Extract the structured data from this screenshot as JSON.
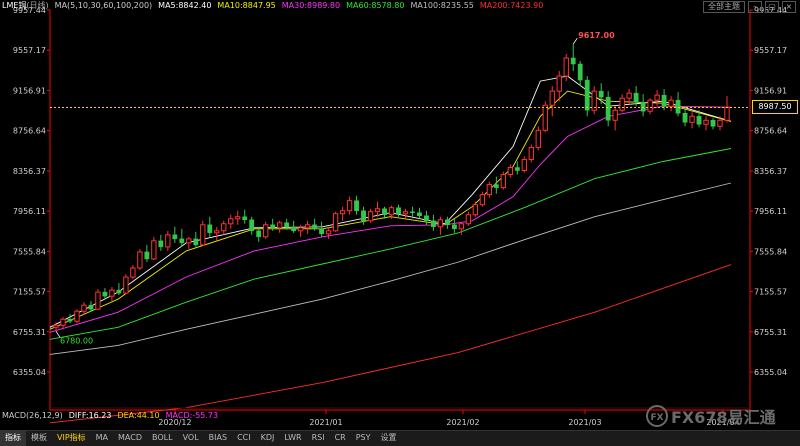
{
  "header": {
    "symbol": "LME铜",
    "period_tag": "(日线)",
    "ma_spec": "MA(5,10,30,60,100,200)",
    "ma5": "MA5:8842.40",
    "ma10": "MA10:8847.95",
    "ma30": "MA30:8989.80",
    "ma60": "MA60:8578.80",
    "ma100": "MA100:8235.55",
    "ma200": "MA200:7423.90",
    "top_button": "全部主题"
  },
  "colors": {
    "up": "#ff3232",
    "down": "#32c84b",
    "ma5": "#ffffff",
    "ma10": "#f0f000",
    "ma30": "#ff32ff",
    "ma60": "#32e632",
    "ma100": "#bebebe",
    "ma200": "#ff2d2d",
    "axis": "#ff0000",
    "last_price": "#ffd400",
    "macd_diff": "#ffffff",
    "macd_dea": "#ffd400",
    "macd_bar": "#ff32ff"
  },
  "chart_data": {
    "type": "candlestick",
    "y_ticks": [
      "9957.44",
      "9557.17",
      "9156.91",
      "8756.64",
      "8356.37",
      "7956.11",
      "7555.84",
      "7155.57",
      "6755.31",
      "6355.04"
    ],
    "ylim": [
      6355.04,
      9957.44
    ],
    "x_labels": [
      "2020/12",
      "2021/01",
      "2021/02",
      "2021/03",
      "2021/04"
    ],
    "annotations": {
      "high_label": "9617.00",
      "low_label": "6780.00",
      "last_price": "8987.50"
    },
    "grid": false,
    "last_price": 8987.5,
    "candles": [
      {
        "o": 6800,
        "h": 6850,
        "l": 6760,
        "c": 6820
      },
      {
        "o": 6820,
        "h": 6900,
        "l": 6790,
        "c": 6880
      },
      {
        "o": 6880,
        "h": 6930,
        "l": 6840,
        "c": 6860
      },
      {
        "o": 6860,
        "h": 6980,
        "l": 6840,
        "c": 6960
      },
      {
        "o": 6960,
        "h": 7050,
        "l": 6930,
        "c": 7020
      },
      {
        "o": 7020,
        "h": 7060,
        "l": 6950,
        "c": 6980
      },
      {
        "o": 6980,
        "h": 7180,
        "l": 6970,
        "c": 7150
      },
      {
        "o": 7150,
        "h": 7190,
        "l": 7080,
        "c": 7110
      },
      {
        "o": 7110,
        "h": 7200,
        "l": 7060,
        "c": 7170
      },
      {
        "o": 7170,
        "h": 7240,
        "l": 7120,
        "c": 7140
      },
      {
        "o": 7140,
        "h": 7330,
        "l": 7130,
        "c": 7300
      },
      {
        "o": 7300,
        "h": 7420,
        "l": 7280,
        "c": 7390
      },
      {
        "o": 7390,
        "h": 7580,
        "l": 7370,
        "c": 7550
      },
      {
        "o": 7550,
        "h": 7620,
        "l": 7450,
        "c": 7480
      },
      {
        "o": 7480,
        "h": 7700,
        "l": 7470,
        "c": 7660
      },
      {
        "o": 7660,
        "h": 7720,
        "l": 7560,
        "c": 7600
      },
      {
        "o": 7600,
        "h": 7760,
        "l": 7560,
        "c": 7720
      },
      {
        "o": 7720,
        "h": 7800,
        "l": 7640,
        "c": 7680
      },
      {
        "o": 7680,
        "h": 7780,
        "l": 7600,
        "c": 7640
      },
      {
        "o": 7640,
        "h": 7700,
        "l": 7580,
        "c": 7680
      },
      {
        "o": 7680,
        "h": 7750,
        "l": 7600,
        "c": 7620
      },
      {
        "o": 7620,
        "h": 7860,
        "l": 7610,
        "c": 7820
      },
      {
        "o": 7820,
        "h": 7900,
        "l": 7700,
        "c": 7740
      },
      {
        "o": 7740,
        "h": 7800,
        "l": 7660,
        "c": 7760
      },
      {
        "o": 7760,
        "h": 7860,
        "l": 7720,
        "c": 7830
      },
      {
        "o": 7830,
        "h": 7920,
        "l": 7780,
        "c": 7880
      },
      {
        "o": 7880,
        "h": 7960,
        "l": 7820,
        "c": 7900
      },
      {
        "o": 7900,
        "h": 7970,
        "l": 7830,
        "c": 7870
      },
      {
        "o": 7870,
        "h": 7900,
        "l": 7720,
        "c": 7760
      },
      {
        "o": 7760,
        "h": 7800,
        "l": 7650,
        "c": 7700
      },
      {
        "o": 7700,
        "h": 7850,
        "l": 7680,
        "c": 7820
      },
      {
        "o": 7820,
        "h": 7880,
        "l": 7760,
        "c": 7790
      },
      {
        "o": 7790,
        "h": 7860,
        "l": 7740,
        "c": 7840
      },
      {
        "o": 7840,
        "h": 7880,
        "l": 7770,
        "c": 7800
      },
      {
        "o": 7800,
        "h": 7860,
        "l": 7740,
        "c": 7760
      },
      {
        "o": 7760,
        "h": 7820,
        "l": 7700,
        "c": 7790
      },
      {
        "o": 7790,
        "h": 7860,
        "l": 7730,
        "c": 7820
      },
      {
        "o": 7820,
        "h": 7880,
        "l": 7760,
        "c": 7780
      },
      {
        "o": 7780,
        "h": 7850,
        "l": 7700,
        "c": 7730
      },
      {
        "o": 7730,
        "h": 7800,
        "l": 7680,
        "c": 7760
      },
      {
        "o": 7760,
        "h": 7950,
        "l": 7750,
        "c": 7930
      },
      {
        "o": 7930,
        "h": 8000,
        "l": 7860,
        "c": 7960
      },
      {
        "o": 7960,
        "h": 8100,
        "l": 7920,
        "c": 8060
      },
      {
        "o": 8060,
        "h": 8110,
        "l": 7920,
        "c": 7960
      },
      {
        "o": 7960,
        "h": 8000,
        "l": 7820,
        "c": 7860
      },
      {
        "o": 7860,
        "h": 7980,
        "l": 7840,
        "c": 7950
      },
      {
        "o": 7950,
        "h": 8050,
        "l": 7900,
        "c": 7980
      },
      {
        "o": 7980,
        "h": 8000,
        "l": 7880,
        "c": 7920
      },
      {
        "o": 7920,
        "h": 8010,
        "l": 7880,
        "c": 7990
      },
      {
        "o": 7990,
        "h": 8020,
        "l": 7900,
        "c": 7930
      },
      {
        "o": 7930,
        "h": 7980,
        "l": 7870,
        "c": 7950
      },
      {
        "o": 7950,
        "h": 8000,
        "l": 7900,
        "c": 7940
      },
      {
        "o": 7940,
        "h": 7990,
        "l": 7880,
        "c": 7910
      },
      {
        "o": 7910,
        "h": 7960,
        "l": 7820,
        "c": 7860
      },
      {
        "o": 7860,
        "h": 7920,
        "l": 7760,
        "c": 7800
      },
      {
        "o": 7800,
        "h": 7900,
        "l": 7720,
        "c": 7870
      },
      {
        "o": 7870,
        "h": 7900,
        "l": 7780,
        "c": 7820
      },
      {
        "o": 7820,
        "h": 7880,
        "l": 7740,
        "c": 7780
      },
      {
        "o": 7780,
        "h": 7850,
        "l": 7720,
        "c": 7830
      },
      {
        "o": 7830,
        "h": 7950,
        "l": 7810,
        "c": 7920
      },
      {
        "o": 7920,
        "h": 8050,
        "l": 7900,
        "c": 8020
      },
      {
        "o": 8020,
        "h": 8150,
        "l": 8000,
        "c": 8120
      },
      {
        "o": 8120,
        "h": 8250,
        "l": 8090,
        "c": 8220
      },
      {
        "o": 8220,
        "h": 8300,
        "l": 8130,
        "c": 8190
      },
      {
        "o": 8190,
        "h": 8350,
        "l": 8170,
        "c": 8320
      },
      {
        "o": 8320,
        "h": 8420,
        "l": 8290,
        "c": 8390
      },
      {
        "o": 8390,
        "h": 8450,
        "l": 8320,
        "c": 8360
      },
      {
        "o": 8360,
        "h": 8500,
        "l": 8340,
        "c": 8470
      },
      {
        "o": 8470,
        "h": 8620,
        "l": 8440,
        "c": 8590
      },
      {
        "o": 8590,
        "h": 8800,
        "l": 8560,
        "c": 8760
      },
      {
        "o": 8760,
        "h": 9050,
        "l": 8740,
        "c": 9010
      },
      {
        "o": 9010,
        "h": 9200,
        "l": 8900,
        "c": 9150
      },
      {
        "o": 9150,
        "h": 9350,
        "l": 9050,
        "c": 9300
      },
      {
        "o": 9300,
        "h": 9520,
        "l": 9250,
        "c": 9480
      },
      {
        "o": 9480,
        "h": 9617,
        "l": 9350,
        "c": 9420
      },
      {
        "o": 9420,
        "h": 9450,
        "l": 9200,
        "c": 9260
      },
      {
        "o": 9260,
        "h": 9300,
        "l": 8900,
        "c": 8960
      },
      {
        "o": 8960,
        "h": 9200,
        "l": 8920,
        "c": 9150
      },
      {
        "o": 9150,
        "h": 9230,
        "l": 9020,
        "c": 9090
      },
      {
        "o": 9090,
        "h": 9150,
        "l": 8800,
        "c": 8860
      },
      {
        "o": 8860,
        "h": 9000,
        "l": 8760,
        "c": 8960
      },
      {
        "o": 8960,
        "h": 9120,
        "l": 8940,
        "c": 9080
      },
      {
        "o": 9080,
        "h": 9170,
        "l": 9020,
        "c": 9130
      },
      {
        "o": 9130,
        "h": 9200,
        "l": 9000,
        "c": 9040
      },
      {
        "o": 9040,
        "h": 9120,
        "l": 8900,
        "c": 8950
      },
      {
        "o": 8950,
        "h": 9080,
        "l": 8920,
        "c": 9060
      },
      {
        "o": 9060,
        "h": 9160,
        "l": 9000,
        "c": 9110
      },
      {
        "o": 9110,
        "h": 9170,
        "l": 8960,
        "c": 9000
      },
      {
        "o": 9000,
        "h": 9100,
        "l": 8950,
        "c": 9060
      },
      {
        "o": 9060,
        "h": 9140,
        "l": 8900,
        "c": 8930
      },
      {
        "o": 8930,
        "h": 9000,
        "l": 8800,
        "c": 8840
      },
      {
        "o": 8840,
        "h": 8940,
        "l": 8780,
        "c": 8900
      },
      {
        "o": 8900,
        "h": 8960,
        "l": 8790,
        "c": 8820
      },
      {
        "o": 8820,
        "h": 8900,
        "l": 8760,
        "c": 8860
      },
      {
        "o": 8860,
        "h": 8880,
        "l": 8770,
        "c": 8800
      },
      {
        "o": 8800,
        "h": 8900,
        "l": 8760,
        "c": 8860
      },
      {
        "o": 8860,
        "h": 9100,
        "l": 8840,
        "c": 8987.5
      }
    ],
    "ma_lines": [
      {
        "name": "MA5",
        "points": [
          [
            0,
            6800
          ],
          [
            10,
            7150
          ],
          [
            20,
            7640
          ],
          [
            30,
            7790
          ],
          [
            40,
            7800
          ],
          [
            50,
            7940
          ],
          [
            58,
            7830
          ],
          [
            62,
            8120
          ],
          [
            68,
            8600
          ],
          [
            72,
            9250
          ],
          [
            76,
            9300
          ],
          [
            82,
            9000
          ],
          [
            90,
            9050
          ],
          [
            100,
            8850
          ]
        ]
      },
      {
        "name": "MA10",
        "points": [
          [
            0,
            6780
          ],
          [
            10,
            7080
          ],
          [
            20,
            7560
          ],
          [
            30,
            7780
          ],
          [
            40,
            7780
          ],
          [
            50,
            7900
          ],
          [
            58,
            7820
          ],
          [
            62,
            8000
          ],
          [
            68,
            8400
          ],
          [
            72,
            8900
          ],
          [
            76,
            9150
          ],
          [
            82,
            9050
          ],
          [
            90,
            9030
          ],
          [
            100,
            8848
          ]
        ]
      },
      {
        "name": "MA30",
        "points": [
          [
            0,
            6750
          ],
          [
            10,
            6950
          ],
          [
            20,
            7300
          ],
          [
            30,
            7560
          ],
          [
            40,
            7700
          ],
          [
            50,
            7810
          ],
          [
            58,
            7820
          ],
          [
            62,
            7860
          ],
          [
            68,
            8100
          ],
          [
            72,
            8420
          ],
          [
            76,
            8700
          ],
          [
            82,
            8900
          ],
          [
            90,
            9000
          ],
          [
            100,
            8990
          ]
        ]
      },
      {
        "name": "MA60",
        "points": [
          [
            0,
            6680
          ],
          [
            10,
            6800
          ],
          [
            20,
            7050
          ],
          [
            30,
            7280
          ],
          [
            40,
            7430
          ],
          [
            50,
            7580
          ],
          [
            60,
            7740
          ],
          [
            70,
            8000
          ],
          [
            80,
            8280
          ],
          [
            90,
            8450
          ],
          [
            100,
            8579
          ]
        ]
      },
      {
        "name": "MA100",
        "points": [
          [
            0,
            6530
          ],
          [
            10,
            6620
          ],
          [
            20,
            6780
          ],
          [
            30,
            6930
          ],
          [
            40,
            7080
          ],
          [
            50,
            7260
          ],
          [
            60,
            7450
          ],
          [
            70,
            7680
          ],
          [
            80,
            7900
          ],
          [
            90,
            8070
          ],
          [
            100,
            8236
          ]
        ]
      },
      {
        "name": "MA200",
        "points": [
          [
            0,
            5850
          ],
          [
            20,
            6000
          ],
          [
            40,
            6250
          ],
          [
            60,
            6550
          ],
          [
            80,
            6950
          ],
          [
            100,
            7424
          ]
        ]
      }
    ]
  },
  "macd": {
    "spec": "MACD(26,12,9)",
    "diff": "DIFF:16.23",
    "dea": "DEA:44.10",
    "macd": "MACD:-55.73"
  },
  "tabs": [
    "指标",
    "模板",
    "VIP指标",
    "MA",
    "MACD",
    "BOLL",
    "VOL",
    "BIAS",
    "CCI",
    "KDJ",
    "LWR",
    "RSI",
    "CR",
    "PSY",
    "设置"
  ],
  "logo": {
    "text": "FX678易汇通",
    "mark": "FX"
  }
}
